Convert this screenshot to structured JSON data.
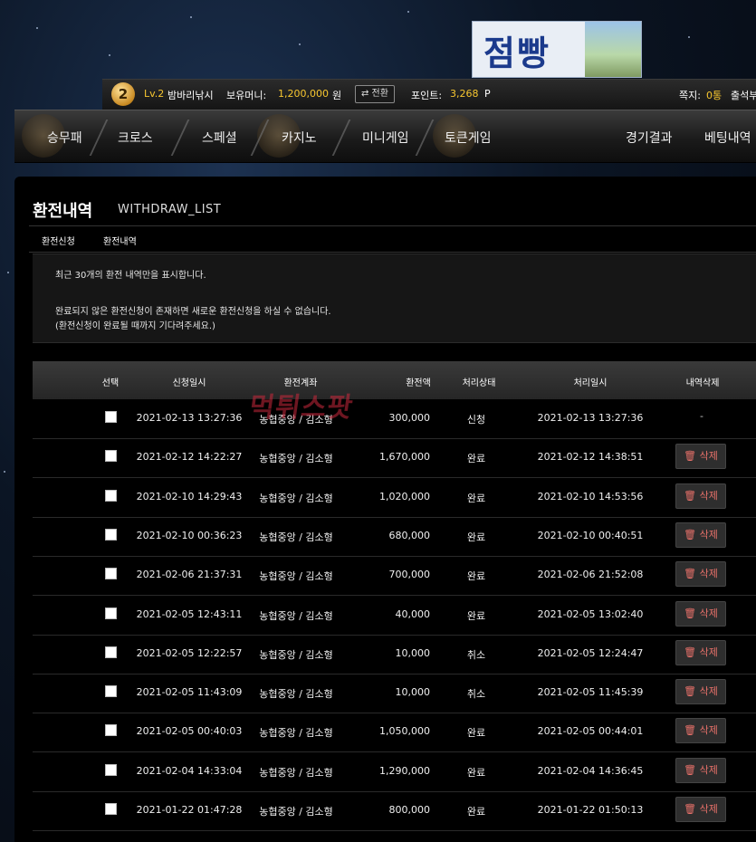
{
  "logo": {
    "text": "점빵"
  },
  "userbar": {
    "level_num": "2",
    "level": "Lv.2",
    "nickname": "밤바리낚시",
    "money_label": "보유머니:",
    "money_value": "1,200,000",
    "money_unit": "원",
    "convert_button": "⇄ 전환",
    "point_label": "포인트:",
    "point_value": "3,268",
    "point_unit": "P",
    "memo_label": "쪽지:",
    "memo_value": "0통",
    "attendance": "출석부"
  },
  "nav": {
    "items": [
      "승무패",
      "크로스",
      "스페셜",
      "카지노",
      "미니게임",
      "토큰게임"
    ],
    "right_items": [
      "경기결과",
      "베팅내역"
    ]
  },
  "page": {
    "title": "환전내역",
    "subtitle": "WITHDRAW_LIST",
    "tabs": [
      "환전신청",
      "환전내역"
    ]
  },
  "notice": {
    "line1": "최근 30개의 환전 내역만을 표시합니다.",
    "line2": "완료되지 않은 환전신청이 존재하면 새로운 환전신청을 하실 수 없습니다.",
    "line3": "(환전신청이 완료될 때까지 기다려주세요.)"
  },
  "table": {
    "headers": {
      "select": "선택",
      "request_time": "신청일시",
      "account": "환전계좌",
      "amount": "환전액",
      "status": "처리상태",
      "processed_time": "처리일시",
      "delete": "내역삭제"
    },
    "delete_label": "🗑 삭제",
    "rows": [
      {
        "request_time": "2021-02-13 13:27:36",
        "account": "농협중앙 / 김소형",
        "amount": "300,000",
        "status": "신청",
        "processed_time": "2021-02-13 13:27:36",
        "delete": "-"
      },
      {
        "request_time": "2021-02-12 14:22:27",
        "account": "농협중앙 / 김소형",
        "amount": "1,670,000",
        "status": "완료",
        "processed_time": "2021-02-12 14:38:51",
        "delete": "button"
      },
      {
        "request_time": "2021-02-10 14:29:43",
        "account": "농협중앙 / 김소형",
        "amount": "1,020,000",
        "status": "완료",
        "processed_time": "2021-02-10 14:53:56",
        "delete": "button"
      },
      {
        "request_time": "2021-02-10 00:36:23",
        "account": "농협중앙 / 김소형",
        "amount": "680,000",
        "status": "완료",
        "processed_time": "2021-02-10 00:40:51",
        "delete": "button"
      },
      {
        "request_time": "2021-02-06 21:37:31",
        "account": "농협중앙 / 김소형",
        "amount": "700,000",
        "status": "완료",
        "processed_time": "2021-02-06 21:52:08",
        "delete": "button"
      },
      {
        "request_time": "2021-02-05 12:43:11",
        "account": "농협중앙 / 김소형",
        "amount": "40,000",
        "status": "완료",
        "processed_time": "2021-02-05 13:02:40",
        "delete": "button"
      },
      {
        "request_time": "2021-02-05 12:22:57",
        "account": "농협중앙 / 김소형",
        "amount": "10,000",
        "status": "취소",
        "processed_time": "2021-02-05 12:24:47",
        "delete": "button"
      },
      {
        "request_time": "2021-02-05 11:43:09",
        "account": "농협중앙 / 김소형",
        "amount": "10,000",
        "status": "취소",
        "processed_time": "2021-02-05 11:45:39",
        "delete": "button"
      },
      {
        "request_time": "2021-02-05 00:40:03",
        "account": "농협중앙 / 김소형",
        "amount": "1,050,000",
        "status": "완료",
        "processed_time": "2021-02-05 00:44:01",
        "delete": "button"
      },
      {
        "request_time": "2021-02-04 14:33:04",
        "account": "농협중앙 / 김소형",
        "amount": "1,290,000",
        "status": "완료",
        "processed_time": "2021-02-04 14:36:45",
        "delete": "button"
      },
      {
        "request_time": "2021-01-22 01:47:28",
        "account": "농협중앙 / 김소형",
        "amount": "800,000",
        "status": "완료",
        "processed_time": "2021-01-22 01:50:13",
        "delete": "button"
      }
    ]
  },
  "watermark": {
    "text": "먹튀스팟"
  },
  "colors": {
    "accent_yellow": "#f7c62f",
    "delete_red": "#e8716a",
    "panel_bg": "#000000"
  }
}
